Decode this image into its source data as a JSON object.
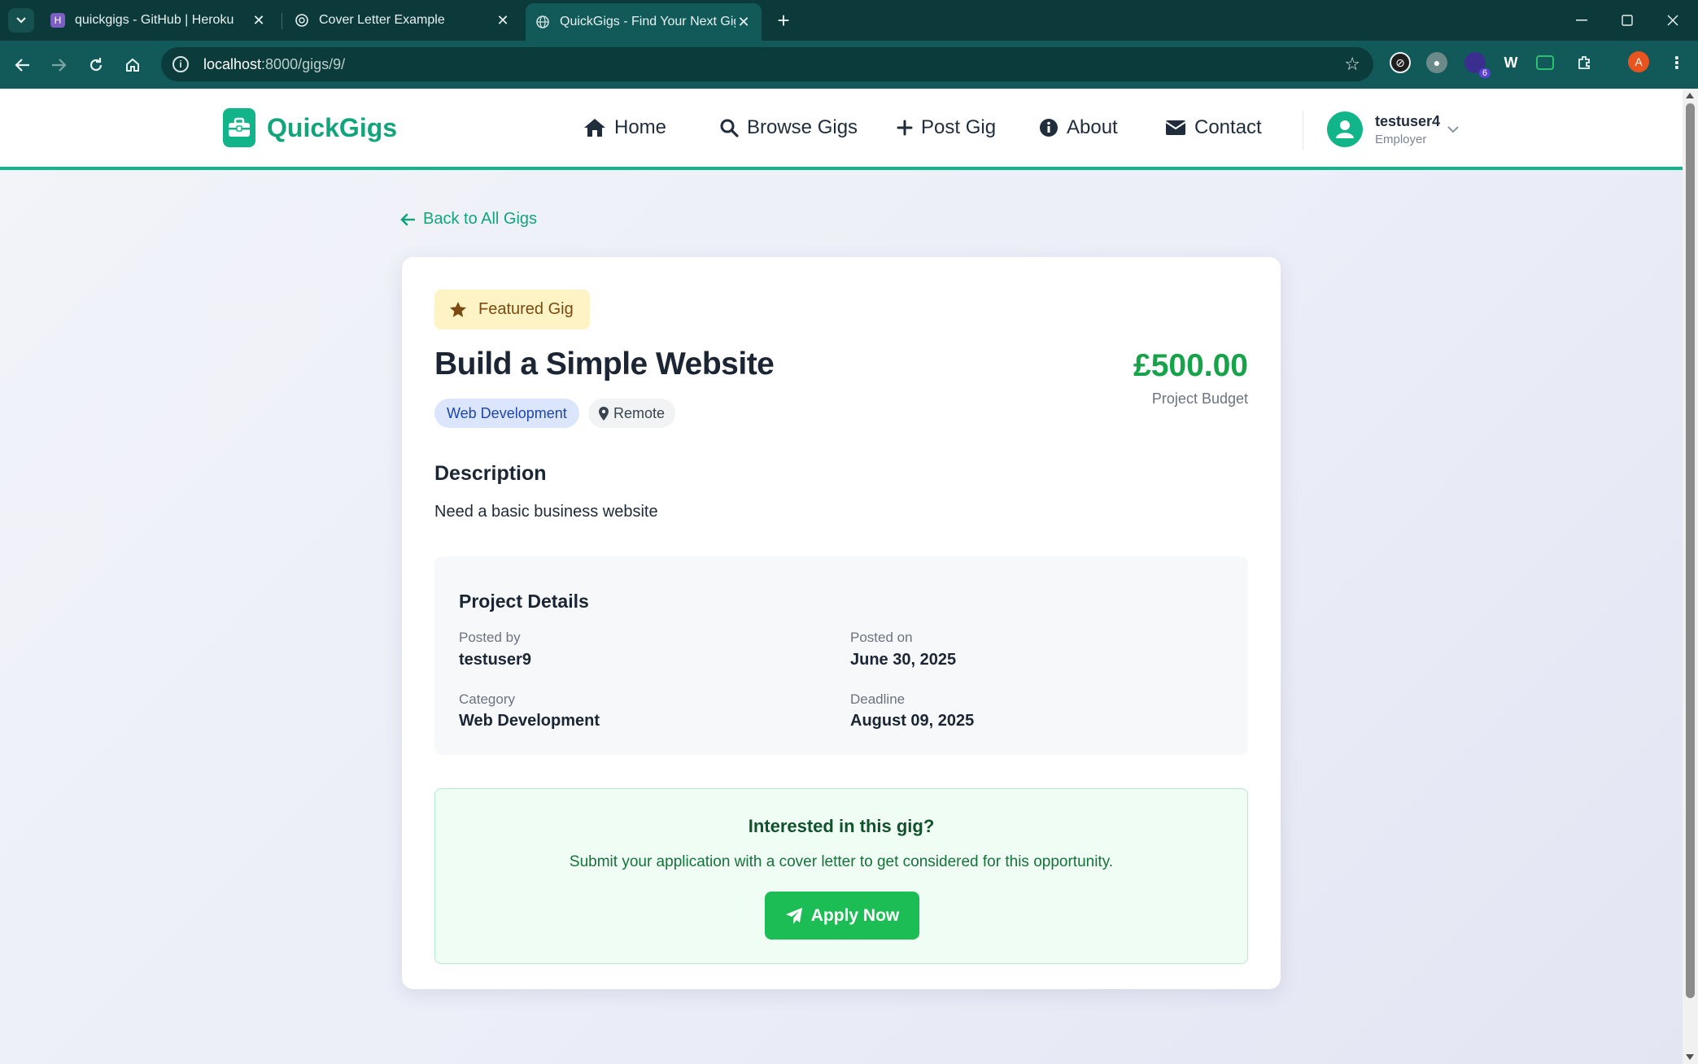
{
  "browser": {
    "tabs": [
      {
        "title": "quickgigs - GitHub | Heroku",
        "icon": "heroku-icon",
        "active": false
      },
      {
        "title": "Cover Letter Example",
        "icon": "openai-icon",
        "active": false
      },
      {
        "title": "QuickGigs - Find Your Next Gig",
        "icon": "globe-icon",
        "active": true
      }
    ],
    "url_host": "localhost",
    "url_path": ":8000/gigs/9/",
    "profile_initial": "A",
    "extension_badge": "6"
  },
  "site": {
    "brand": "QuickGigs",
    "nav": [
      {
        "label": "Home",
        "icon": "home-icon"
      },
      {
        "label": "Browse Gigs",
        "icon": "search-icon"
      },
      {
        "label": "Post Gig",
        "icon": "plus-icon"
      },
      {
        "label": "About",
        "icon": "info-icon"
      },
      {
        "label": "Contact",
        "icon": "envelope-icon"
      }
    ],
    "user": {
      "name": "testuser4",
      "role": "Employer"
    },
    "accent": "#12b58a"
  },
  "gig": {
    "back_label": "Back to All Gigs",
    "featured_label": "Featured Gig",
    "title": "Build a Simple Website",
    "price": "£500.00",
    "price_label": "Project Budget",
    "category_tag": "Web Development",
    "location_tag": "Remote",
    "description_heading": "Description",
    "description": "Need a basic business website",
    "details": {
      "heading": "Project Details",
      "posted_by_label": "Posted by",
      "posted_by": "testuser9",
      "posted_on_label": "Posted on",
      "posted_on": "June 30, 2025",
      "category_label": "Category",
      "category": "Web Development",
      "deadline_label": "Deadline",
      "deadline": "August 09, 2025"
    },
    "apply": {
      "heading": "Interested in this gig?",
      "text": "Submit your application with a cover letter to get considered for this opportunity.",
      "button": "Apply Now"
    }
  }
}
